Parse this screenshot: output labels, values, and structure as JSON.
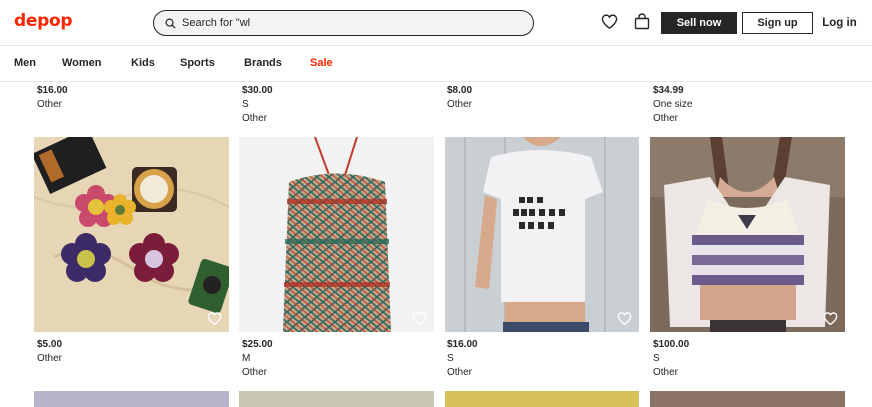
{
  "header": {
    "logo": "depop",
    "search_value": "Search for \"wl",
    "sell_now": "Sell now",
    "sign_up": "Sign up",
    "log_in": "Log in"
  },
  "nav": [
    "Men",
    "Women",
    "Kids",
    "Sports",
    "Brands",
    "Sale"
  ],
  "top_row": [
    {
      "price": "$16.00",
      "lines": [
        "Other"
      ]
    },
    {
      "price": "$30.00",
      "lines": [
        "S",
        "Other"
      ]
    },
    {
      "price": "$8.00",
      "lines": [
        "Other"
      ]
    },
    {
      "price": "$34.99",
      "lines": [
        "One size",
        "Other"
      ]
    }
  ],
  "products": [
    {
      "price": "$5.00",
      "lines": [
        "Other"
      ],
      "image": "crochet-coasters-photo"
    },
    {
      "price": "$25.00",
      "lines": [
        "M",
        "Other"
      ],
      "image": "crochet-halter-top-photo"
    },
    {
      "price": "$16.00",
      "lines": [
        "S",
        "Other"
      ],
      "image": "graphic-baby-tee-photo"
    },
    {
      "price": "$100.00",
      "lines": [
        "S",
        "Other"
      ],
      "image": "knit-cardigan-photo"
    }
  ],
  "colors": {
    "brand": "#ff2300",
    "dark": "#262626"
  }
}
